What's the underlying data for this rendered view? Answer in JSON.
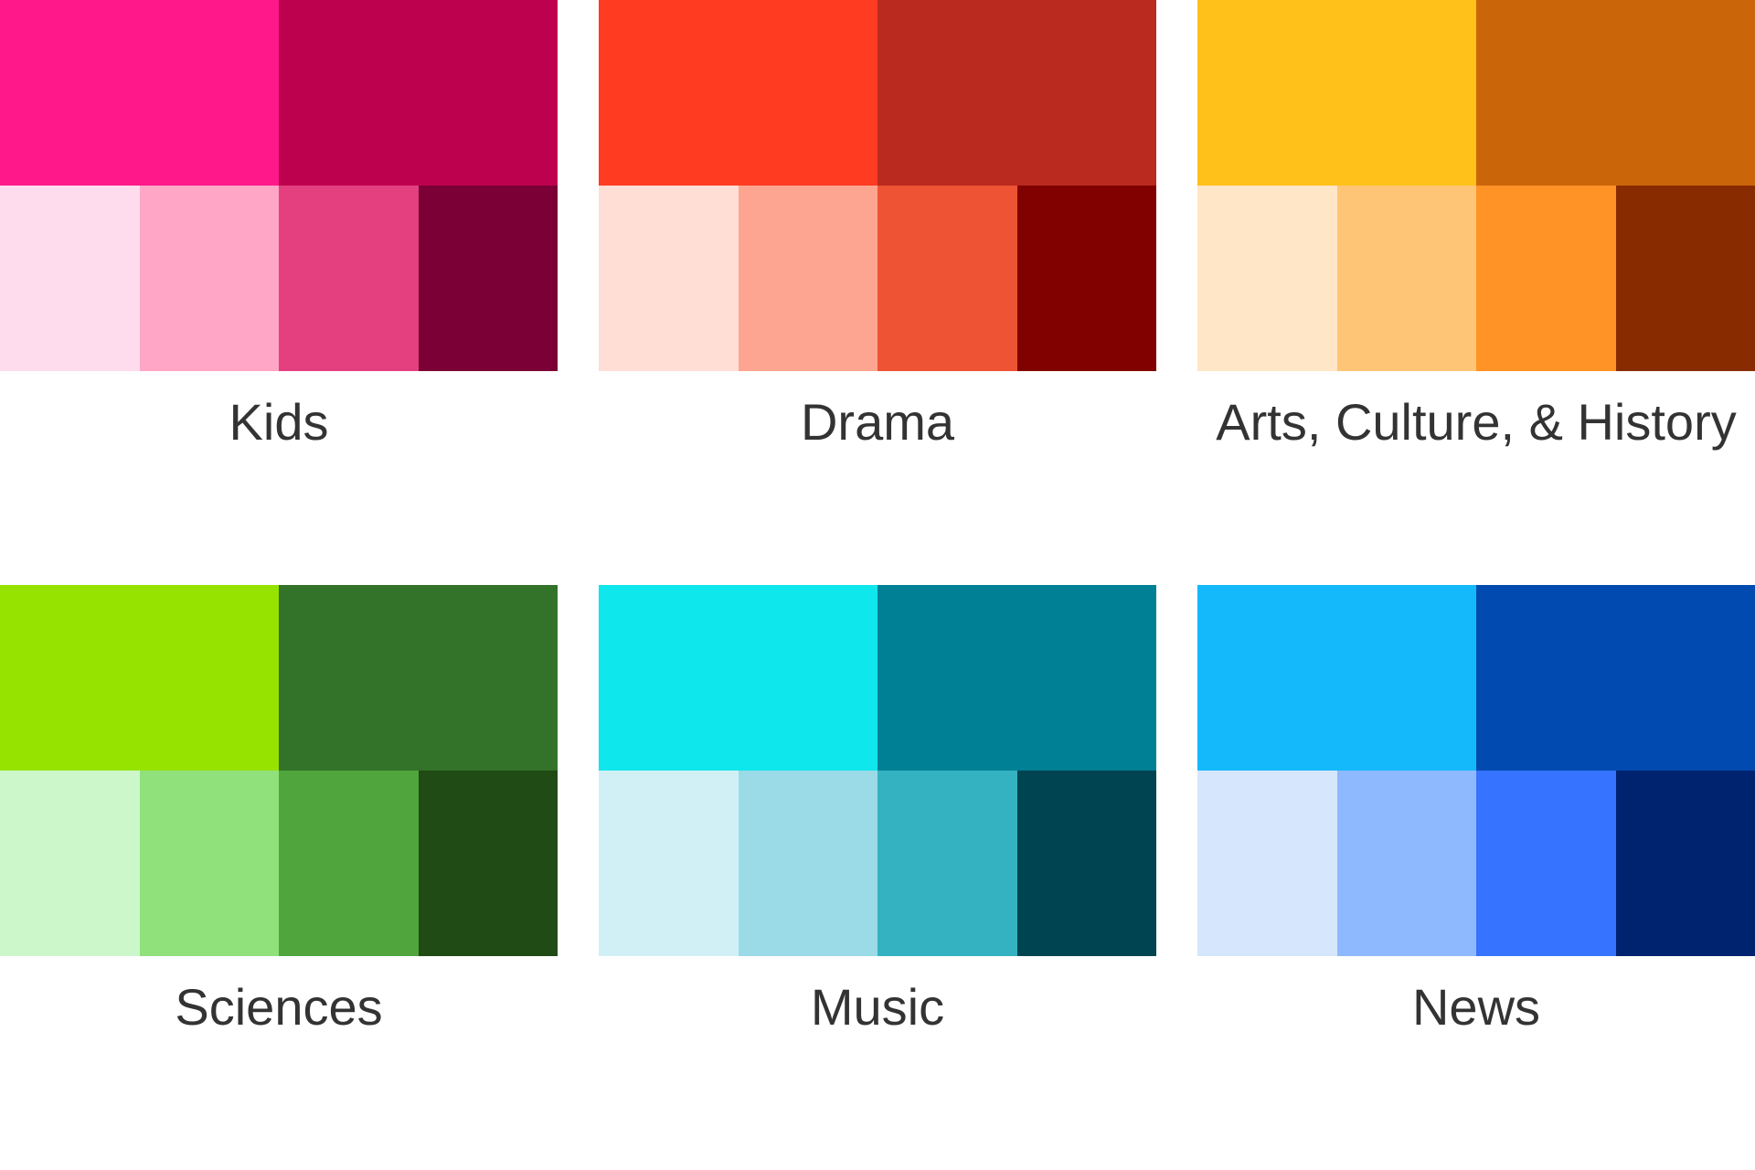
{
  "palettes": [
    {
      "label": "Kids",
      "primary": [
        "#FF1889",
        "#BD014F"
      ],
      "shades": [
        "#FFDBEE",
        "#FFA5C6",
        "#E44080",
        "#7A0036"
      ]
    },
    {
      "label": "Drama",
      "primary": [
        "#FF3B22",
        "#BA2A1F"
      ],
      "shades": [
        "#FFDED5",
        "#FDA590",
        "#EE5333",
        "#810000"
      ]
    },
    {
      "label": "Arts, Culture, & History",
      "primary": [
        "#FFC11A",
        "#CB6509"
      ],
      "shades": [
        "#FFE6C6",
        "#FFC577",
        "#FF9326",
        "#892B00"
      ]
    },
    {
      "label": "Sciences",
      "primary": [
        "#97E300",
        "#327229"
      ],
      "shades": [
        "#CCF7CA",
        "#90E17B",
        "#50A63C",
        "#204B14"
      ]
    },
    {
      "label": "Music",
      "primary": [
        "#0EE7EC",
        "#008095"
      ],
      "shades": [
        "#D1F0F6",
        "#9BDAE7",
        "#35B2C1",
        "#004451"
      ]
    },
    {
      "label": "News",
      "primary": [
        "#14B9FC",
        "#014AAF"
      ],
      "shades": [
        "#D6E6FC",
        "#8EB9FF",
        "#3673FF",
        "#002370"
      ]
    }
  ]
}
